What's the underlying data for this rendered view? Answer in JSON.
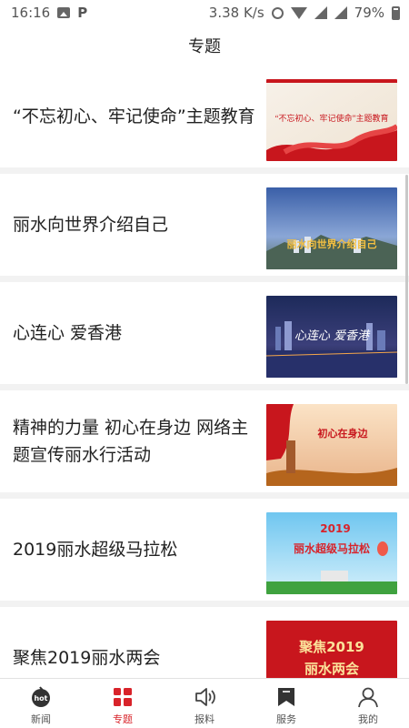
{
  "status_bar": {
    "time": "16:16",
    "speed": "3.38 K/s",
    "battery": "79%"
  },
  "header": {
    "title": "专题"
  },
  "topics": [
    {
      "title": "“不忘初心、牢记使命”主题教育",
      "thumb_text": "“不忘初心、牢记使命”主题教育"
    },
    {
      "title": "丽水向世界介绍自己",
      "thumb_text": "丽水向世界介绍自己"
    },
    {
      "title": "心连心 爱香港",
      "thumb_text": "心连心 爱香港"
    },
    {
      "title": "精神的力量 初心在身边 网络主题宣传丽水行活动",
      "thumb_text": "初心在身边"
    },
    {
      "title": "2019丽水超级马拉松",
      "thumb_text_1": "2019",
      "thumb_text_2": "丽水超级马拉松"
    },
    {
      "title": "聚焦2019丽水两会",
      "thumb_text_1": "聚焦2019",
      "thumb_text_2": "丽水两会"
    }
  ],
  "tabs": [
    {
      "label": "新闻",
      "icon": "hot-icon",
      "badge": "hot"
    },
    {
      "label": "专题",
      "icon": "grid-icon",
      "active": true
    },
    {
      "label": "报料",
      "icon": "speaker-icon"
    },
    {
      "label": "服务",
      "icon": "bookmark-icon"
    },
    {
      "label": "我的",
      "icon": "user-icon"
    }
  ],
  "colors": {
    "accent": "#d8232a",
    "divider": "#f2f2f2"
  }
}
